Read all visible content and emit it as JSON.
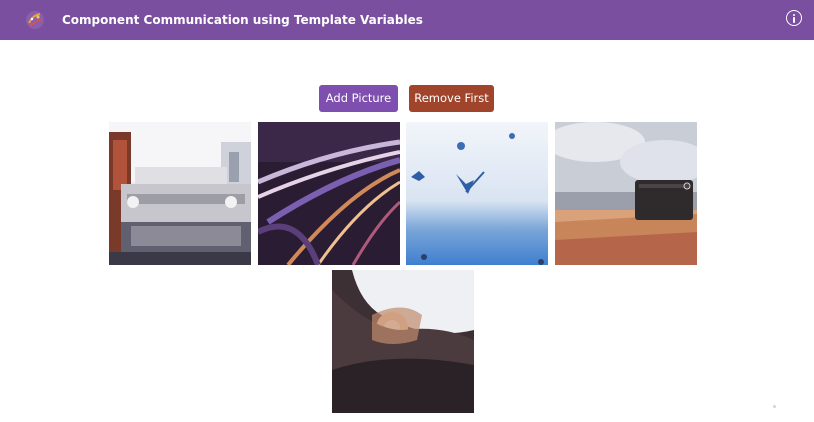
{
  "header": {
    "title": "Component Communication using Template Variables",
    "logo_icon": "app-logo-icon",
    "info_icon": "info-icon",
    "background_color": "#7a4fa0"
  },
  "toolbar": {
    "add_label": "Add Picture",
    "add_color": "#7e4fae",
    "remove_label": "Remove First",
    "remove_color": "#a0442c"
  },
  "gallery": {
    "pictures": [
      {
        "description_icon": "vintage-car-photo"
      },
      {
        "description_icon": "light-trails-photo"
      },
      {
        "description_icon": "flying-birds-sky-photo"
      },
      {
        "description_icon": "field-with-suitcase-photo"
      },
      {
        "description_icon": "sunset-hand-photo"
      }
    ]
  }
}
